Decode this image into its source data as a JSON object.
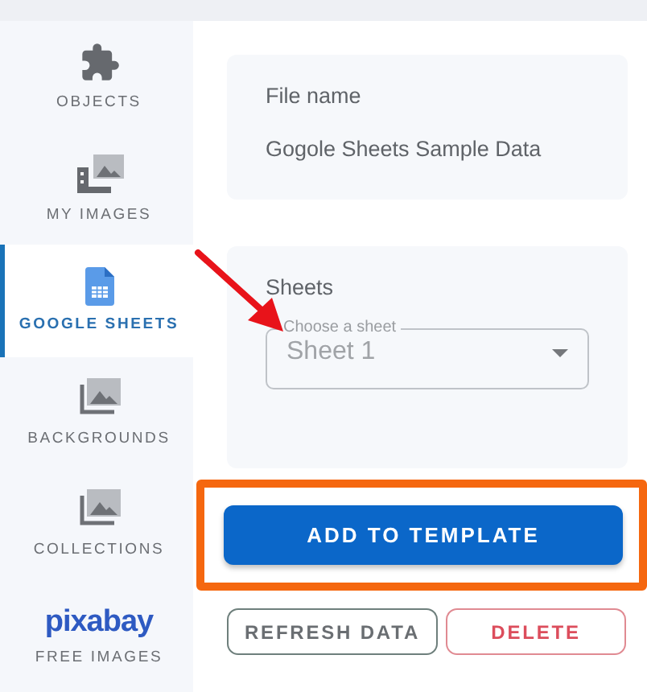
{
  "sidebar": {
    "items": [
      {
        "kind": "puzzle",
        "label": "OBJECTS",
        "selected": false
      },
      {
        "kind": "images",
        "label": "MY IMAGES",
        "selected": false
      },
      {
        "kind": "sheet",
        "label": "GOOGLE SHEETS",
        "selected": true
      },
      {
        "kind": "stack",
        "label": "BACKGROUNDS",
        "selected": false
      },
      {
        "kind": "stack",
        "label": "COLLECTIONS",
        "selected": false
      },
      {
        "kind": "logo",
        "logo_text": "pixabay",
        "label": "FREE IMAGES",
        "selected": false
      }
    ]
  },
  "file_card": {
    "label": "File name",
    "value": "Gogole Sheets Sample Data"
  },
  "sheets_card": {
    "label": "Sheets",
    "select": {
      "floating_label": "Choose a sheet",
      "value": "Sheet 1"
    }
  },
  "primary_button": {
    "label": "ADD TO TEMPLATE",
    "highlighted": true
  },
  "buttons": [
    {
      "kind": "neutral",
      "label": "REFRESH DATA"
    },
    {
      "kind": "danger",
      "label": "DELETE"
    }
  ],
  "annotation_arrow": true
}
